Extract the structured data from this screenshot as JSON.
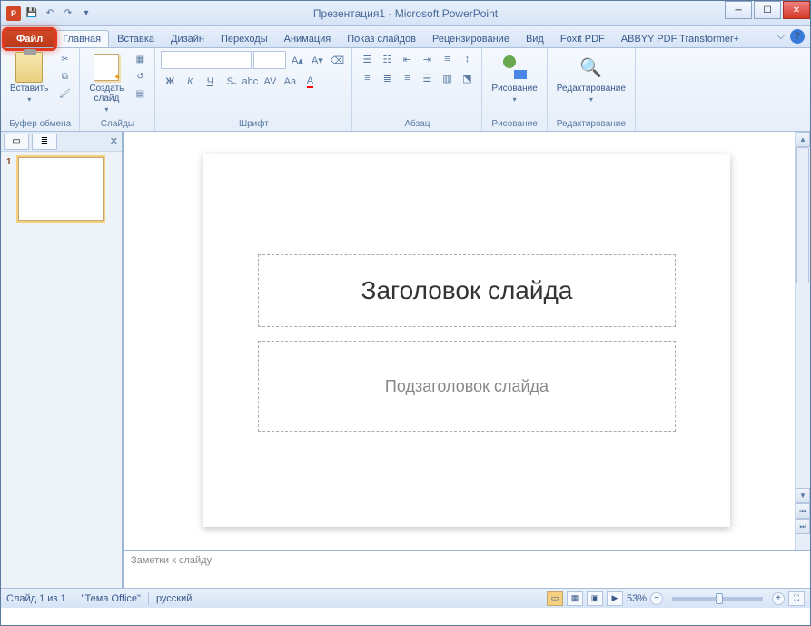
{
  "title": "Презентация1 - Microsoft PowerPoint",
  "tabs": {
    "file": "Файл",
    "home": "Главная",
    "insert": "Вставка",
    "design": "Дизайн",
    "transitions": "Переходы",
    "animations": "Анимация",
    "slideshow": "Показ слайдов",
    "review": "Рецензирование",
    "view": "Вид",
    "foxit": "Foxit PDF",
    "abbyy": "ABBYY PDF Transformer+"
  },
  "ribbon": {
    "clipboard": {
      "paste": "Вставить",
      "label": "Буфер обмена"
    },
    "slides": {
      "new_slide": "Создать\nслайд",
      "label": "Слайды"
    },
    "font": {
      "label": "Шрифт"
    },
    "paragraph": {
      "label": "Абзац"
    },
    "drawing": {
      "draw": "Рисование",
      "label": "Рисование"
    },
    "editing": {
      "edit": "Редактирование",
      "label": "Редактирование"
    }
  },
  "slide": {
    "number": "1",
    "title_placeholder": "Заголовок слайда",
    "subtitle_placeholder": "Подзаголовок слайда"
  },
  "notes": {
    "placeholder": "Заметки к слайду"
  },
  "status": {
    "slide_count": "Слайд 1 из 1",
    "theme": "\"Тема Office\"",
    "language": "русский",
    "zoom": "53%"
  }
}
